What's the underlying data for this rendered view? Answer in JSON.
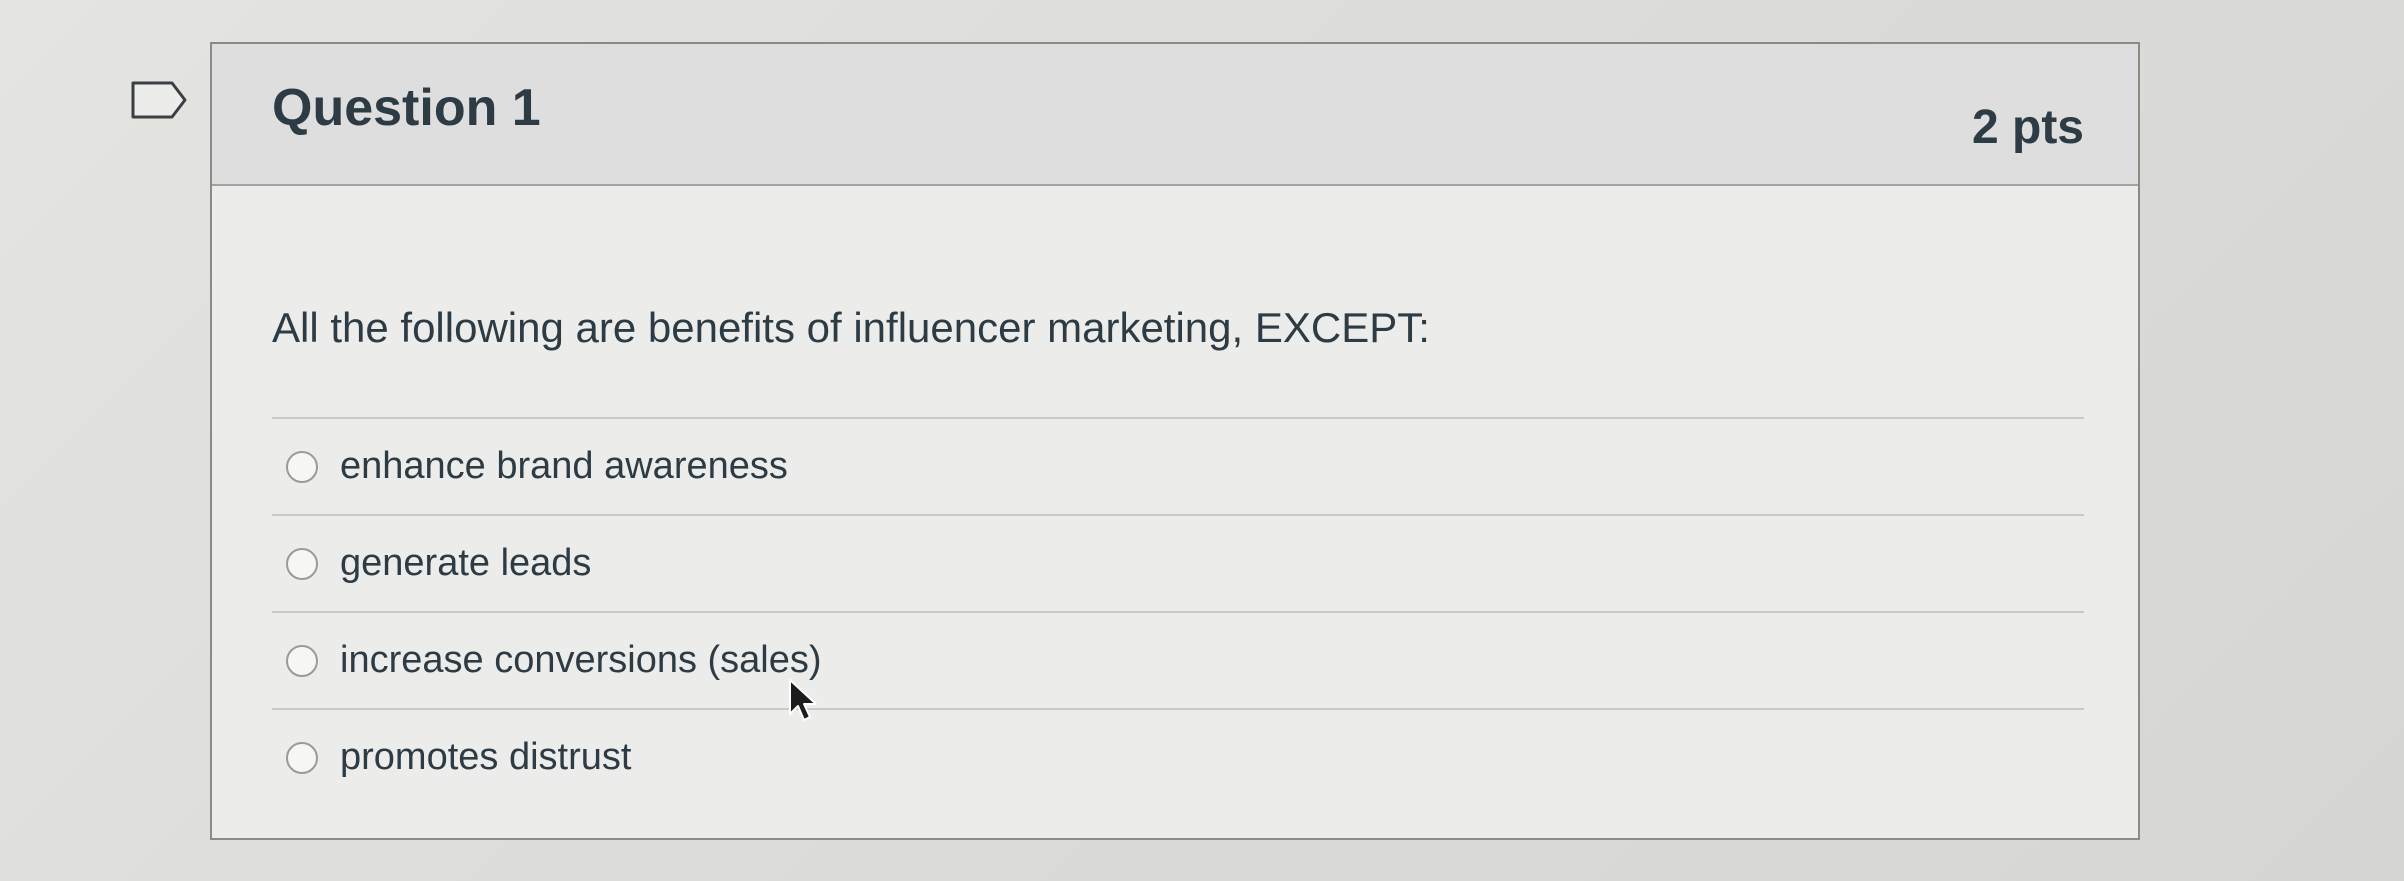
{
  "question": {
    "title": "Question 1",
    "points": "2 pts",
    "text": "All the following are benefits of influencer marketing, EXCEPT:",
    "answers": [
      {
        "label": "enhance brand awareness",
        "selected": false
      },
      {
        "label": "generate leads",
        "selected": false
      },
      {
        "label": "increase conversions (sales)",
        "selected": false
      },
      {
        "label": "promotes distrust",
        "selected": false
      }
    ]
  },
  "icons": {
    "flag": "flag-question-icon",
    "cursor": "mouse-pointer-icon"
  },
  "colors": {
    "text": "#2d3b45",
    "header_bg": "#dedede",
    "border": "#8a8a88"
  }
}
